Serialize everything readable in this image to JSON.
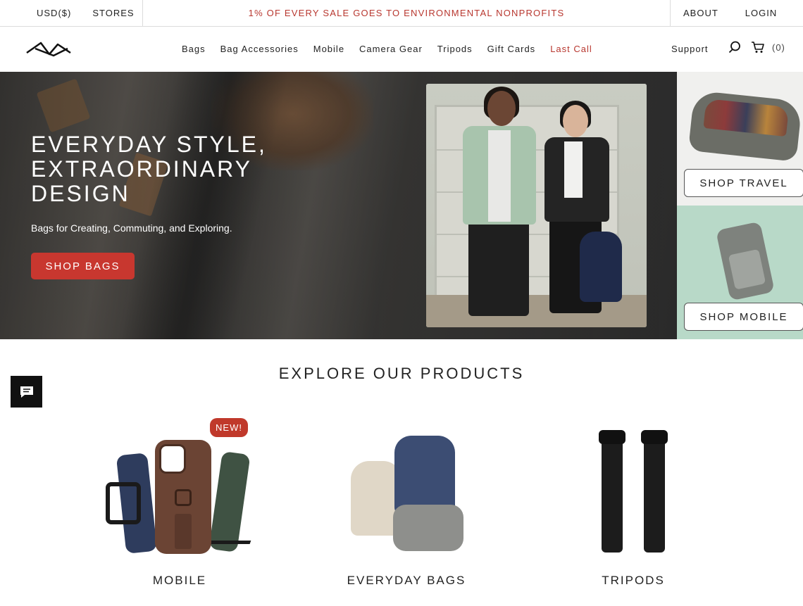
{
  "topbar": {
    "currency": "USD($)",
    "stores": "STORES",
    "promo": "1% OF EVERY SALE GOES TO ENVIRONMENTAL NONPROFITS",
    "about": "ABOUT",
    "login": "LOGIN"
  },
  "nav": {
    "items": [
      "Bags",
      "Bag Accessories",
      "Mobile",
      "Camera Gear",
      "Tripods",
      "Gift Cards",
      "Last Call"
    ],
    "support": "Support",
    "cart_count": "(0)",
    "sale_color": "#b8372f"
  },
  "hero": {
    "title_line1": "EVERYDAY STYLE,",
    "title_line2": "EXTRAORDINARY",
    "title_line3": "DESIGN",
    "subtitle": "Bags for Creating, Commuting, and Exploring.",
    "cta": "SHOP BAGS",
    "cta_color": "#c8372f"
  },
  "tiles": {
    "travel": "SHOP TRAVEL",
    "mobile": "SHOP MOBILE"
  },
  "explore": {
    "title": "EXPLORE OUR PRODUCTS",
    "new_badge": "NEW!",
    "products": [
      {
        "label": "MOBILE"
      },
      {
        "label": "EVERYDAY BAGS"
      },
      {
        "label": "TRIPODS"
      }
    ]
  }
}
